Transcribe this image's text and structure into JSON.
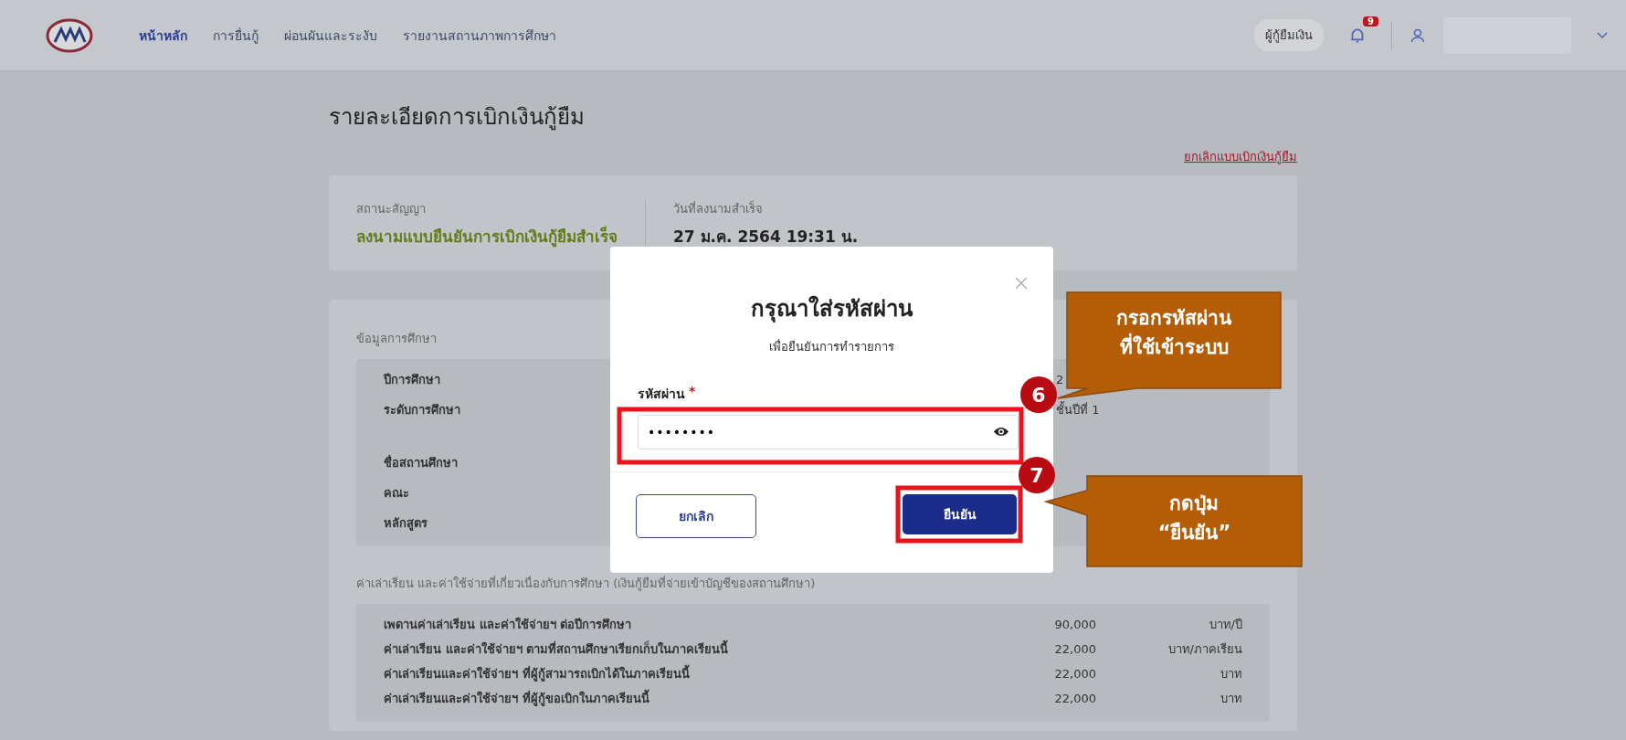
{
  "nav": {
    "items": [
      {
        "label": "หน้าหลัก",
        "selected": true
      },
      {
        "label": "การยื่นกู้",
        "selected": false
      },
      {
        "label": "ผ่อนผันและระงับ",
        "selected": false
      },
      {
        "label": "รายงานสถานภาพการศึกษา",
        "selected": false
      }
    ],
    "role_chip": "ผู้กู้ยืมเงิน",
    "notification_count": "9"
  },
  "page": {
    "title": "รายละเอียดการเบิกเงินกู้ยืม",
    "cancel_link": "ยกเลิกแบบเบิกเงินกู้ยืม"
  },
  "status_card": {
    "fields": [
      {
        "label": "สถานะสัญญา",
        "value": "ลงนามแบบยืนยันการเบิกเงินกู้ยืมสำเร็จ",
        "kind": "status"
      },
      {
        "label": "วันที่ลงนามสำเร็จ",
        "value": "27 ม.ค. 2564 19:31 น.",
        "kind": "date"
      }
    ]
  },
  "education": {
    "heading": "ข้อมูลการศึกษา",
    "groups": [
      [
        {
          "label": "ปีการศึกษา",
          "value": "2"
        },
        {
          "label": "ระดับการศึกษา",
          "value": "ชั้นปีที่ 1"
        }
      ],
      [
        {
          "label": "ชื่อสถานศึกษา"
        },
        {
          "label": "คณะ"
        },
        {
          "label": "หลักสูตร"
        }
      ]
    ]
  },
  "fees": {
    "heading": "ค่าเล่าเรียน และค่าใช้จ่ายที่เกี่ยวเนื่องกับการศึกษา (เงินกู้ยืมที่จ่ายเข้าบัญชีของสถานศึกษา)",
    "rows": [
      {
        "label": "เพดานค่าเล่าเรียน และค่าใช้จ่ายฯ ต่อปีการศึกษา",
        "amount": "90,000",
        "unit": "บาท/ปี"
      },
      {
        "label": "ค่าเล่าเรียน และค่าใช้จ่ายฯ ตามที่สถานศึกษาเรียกเก็บในภาคเรียนนี้",
        "amount": "22,000",
        "unit": "บาท/ภาคเรียน"
      },
      {
        "label": "ค่าเล่าเรียนและค่าใช้จ่ายฯ ที่ผู้กู้สามารถเบิกได้ในภาคเรียนนี้",
        "amount": "22,000",
        "unit": "บาท"
      },
      {
        "label": "ค่าเล่าเรียนและค่าใช้จ่ายฯ ที่ผู้กู้ขอเบิกในภาคเรียนนี้",
        "amount": "22,000",
        "unit": "บาท"
      }
    ]
  },
  "modal": {
    "title": "กรุณาใส่รหัสผ่าน",
    "subtitle": "เพื่อยืนยันการทำรายการ",
    "field_label": "รหัสผ่าน",
    "required_mark": "*",
    "value": "••••••••",
    "buttons": [
      {
        "label": "ยกเลิก",
        "kind": "secondary"
      },
      {
        "label": "ยืนยัน",
        "kind": "primary"
      }
    ]
  },
  "callouts": [
    {
      "number": "6",
      "lines": [
        "กรอกรหัสผ่าน",
        "ที่ใช้เข้าระบบ"
      ]
    },
    {
      "number": "7",
      "lines": [
        "กดปุ่ม",
        "“ยืนยัน”"
      ]
    }
  ]
}
